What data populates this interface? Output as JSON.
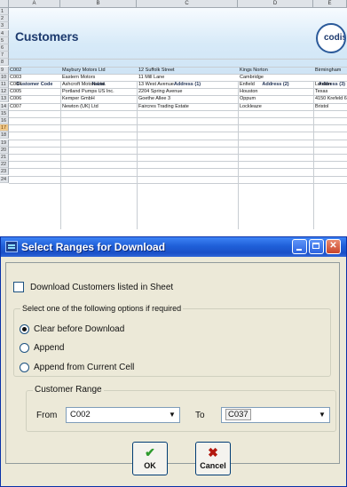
{
  "sheet": {
    "columns": [
      "A",
      "B",
      "C",
      "D",
      "E"
    ],
    "rows": [
      "1",
      "2",
      "3",
      "4",
      "5",
      "6",
      "7",
      "8",
      "9",
      "10",
      "11",
      "12",
      "13",
      "14",
      "15",
      "16",
      "17",
      "18",
      "19",
      "20",
      "21",
      "22",
      "23",
      "24"
    ],
    "highlighted_row": "17",
    "title": "Customers",
    "logo_text": "codis",
    "headers": [
      "Customer Code",
      "Name",
      "Address (1)",
      "Address (2)",
      "Address (3)"
    ],
    "data": [
      [
        "C002",
        "Maybury Motors Ltd",
        "12 Suffolk Street",
        "Kings Norton",
        "Birmingham"
      ],
      [
        "C003",
        "Eastern Motors",
        "11 Mill Lane",
        "Cambridge",
        ""
      ],
      [
        "C004",
        "Ashcroft Motors Ltd.",
        "13 West Avenue",
        "Enfield",
        "London"
      ],
      [
        "C005",
        "Portland Pumps US Inc.",
        "2204 Spring Avenue",
        "Houston",
        "Texas"
      ],
      [
        "C006",
        "Kemper GmbH",
        "Goethe Allee 3",
        "Oppum",
        "4150 Krefeld 6"
      ],
      [
        "C007",
        "Newton (UK) Ltd",
        "Faircres Trading Estate",
        "Lockleaze",
        "Bristol"
      ]
    ]
  },
  "dialog": {
    "title": "Select Ranges for Download",
    "checkbox_label": "Download Customers listed in Sheet",
    "checkbox_checked": false,
    "options_group_label": "Select one of the following options if required",
    "options": [
      {
        "label": "Clear before Download",
        "selected": true
      },
      {
        "label": "Append",
        "selected": false
      },
      {
        "label": "Append from Current Cell",
        "selected": false
      }
    ],
    "range_group_label": "Customer Range",
    "from_label": "From",
    "from_value": "C002",
    "to_label": "To",
    "to_value": "C037",
    "ok_label": "OK",
    "cancel_label": "Cancel",
    "colors": {
      "titlebar": "#1f5fd8",
      "dialog_bg": "#ece9d8",
      "ok_icon": "#2e9b2e",
      "cancel_icon": "#b3180f"
    }
  }
}
